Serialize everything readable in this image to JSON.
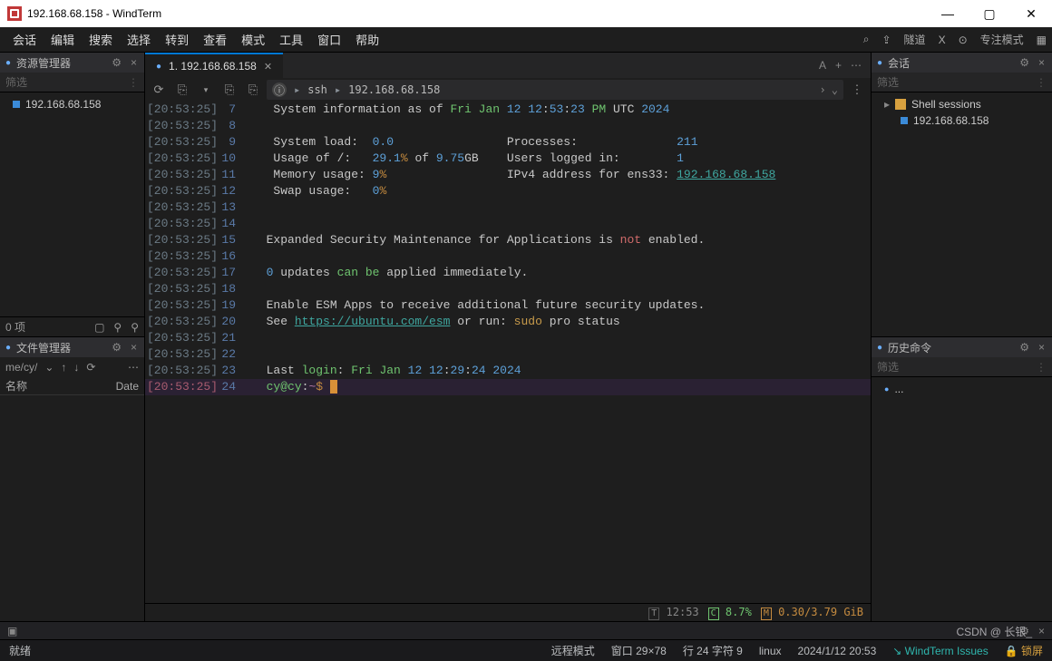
{
  "window": {
    "title": "192.168.68.158 - WindTerm"
  },
  "win_controls": {
    "min": "—",
    "max": "▢",
    "close": "✕"
  },
  "menu": [
    "会话",
    "编辑",
    "搜索",
    "选择",
    "转到",
    "查看",
    "模式",
    "工具",
    "窗口",
    "帮助"
  ],
  "menu_right": {
    "search": "⌕",
    "tunnel_icon": "⇪",
    "tunnel": "隧道",
    "x": "X",
    "focus_icon": "⊙",
    "focus": "专注模式",
    "layout": "▦"
  },
  "left": {
    "explorer_title": "资源管理器",
    "filter_placeholder": "筛选",
    "sessions": [
      {
        "name": "192.168.68.158"
      }
    ],
    "explorer_status": "0 项",
    "files_title": "文件管理器",
    "path": "me/cy/",
    "col_name": "名称",
    "col_date": "Date"
  },
  "tab": {
    "label": "1. 192.168.68.158",
    "A": "A",
    "plus": "+"
  },
  "toolbar": {
    "sync": "⟳",
    "c1": "⎘",
    "c2": "⎘",
    "c3": "⎘",
    "info": "ⓘ",
    "sep": "▸",
    "p1": "ssh",
    "p2": "192.168.68.158",
    "chev_r": "›",
    "chev_d": "⌄",
    "more": "⋮"
  },
  "term": {
    "lines": [
      {
        "ts": "[20:53:25]",
        "n": "7",
        "html": "   System information as of <span class='g'>Fri</span> <span class='g'>Jan</span> <span class='b'>12</span> <span class='b'>12</span>:<span class='b'>53</span>:<span class='b'>23</span> <span class='g'>PM</span> UTC <span class='b'>2024</span>"
      },
      {
        "ts": "[20:53:25]",
        "n": "8",
        "html": ""
      },
      {
        "ts": "[20:53:25]",
        "n": "9",
        "html": "   System load:  <span class='b'>0.0</span>                Processes:              <span class='b'>211</span>"
      },
      {
        "ts": "[20:53:25]",
        "n": "10",
        "html": "   Usage of /:   <span class='b'>29.1</span><span class='o'>%</span> of <span class='b'>9.75</span>GB    Users logged in:        <span class='b'>1</span>"
      },
      {
        "ts": "[20:53:25]",
        "n": "11",
        "html": "   Memory usage: <span class='b'>9</span><span class='o'>%</span>                 IPv4 address for ens33: <span class='link'>192.168.68.158</span>"
      },
      {
        "ts": "[20:53:25]",
        "n": "12",
        "html": "   Swap usage:   <span class='b'>0</span><span class='o'>%</span>"
      },
      {
        "ts": "[20:53:25]",
        "n": "13",
        "html": ""
      },
      {
        "ts": "[20:53:25]",
        "n": "14",
        "html": ""
      },
      {
        "ts": "[20:53:25]",
        "n": "15",
        "html": "  Expanded Security Maintenance for Applications is <span class='r'>not</span> enabled."
      },
      {
        "ts": "[20:53:25]",
        "n": "16",
        "html": ""
      },
      {
        "ts": "[20:53:25]",
        "n": "17",
        "html": "  <span class='b'>0</span> updates <span class='g'>can</span> <span class='g'>be</span> applied immediately."
      },
      {
        "ts": "[20:53:25]",
        "n": "18",
        "html": ""
      },
      {
        "ts": "[20:53:25]",
        "n": "19",
        "html": "  Enable ESM Apps to receive additional future security updates."
      },
      {
        "ts": "[20:53:25]",
        "n": "20",
        "html": "  See <span class='link'>https://ubuntu.com/esm</span> or run: <span class='y'>sudo</span> pro status"
      },
      {
        "ts": "[20:53:25]",
        "n": "21",
        "html": ""
      },
      {
        "ts": "[20:53:25]",
        "n": "22",
        "html": ""
      },
      {
        "ts": "[20:53:25]",
        "n": "23",
        "html": "  Last <span class='g'>login</span>: <span class='g'>Fri</span> <span class='g'>Jan</span> <span class='b'>12</span> <span class='b'>12</span>:<span class='b'>29</span>:<span class='b'>24</span> <span class='b'>2024</span>"
      },
      {
        "ts": "[20:53:25]",
        "n": "24",
        "cur": true,
        "html": "  <span class='g'>cy@cy</span>:<span class='pk'>~</span><span class='o'>$</span> <span class='cursor'></span>"
      }
    ]
  },
  "bottom": {
    "t_badge": "T",
    "time": "12:53",
    "c_badge": "C",
    "cpu": "8.7%",
    "m_badge": "M",
    "mem": "0.30/3.79 GiB"
  },
  "right": {
    "sessions_title": "会话",
    "filter_placeholder": "筛选",
    "tree_root": "Shell sessions",
    "tree_item": "192.168.68.158",
    "history_title": "历史命令",
    "history_filter": "筛选",
    "history_item": "..."
  },
  "dock": {
    "icon": "▣"
  },
  "status": {
    "ready": "就绪",
    "remote": "远程模式",
    "win": "窗口 29×78",
    "cursor": "行 24 字符 9",
    "os": "linux",
    "datetime": "2024/1/12 20:53",
    "issues": "WindTerm Issues",
    "lock": "锁屏"
  },
  "watermark": "CSDN @ 长银_"
}
